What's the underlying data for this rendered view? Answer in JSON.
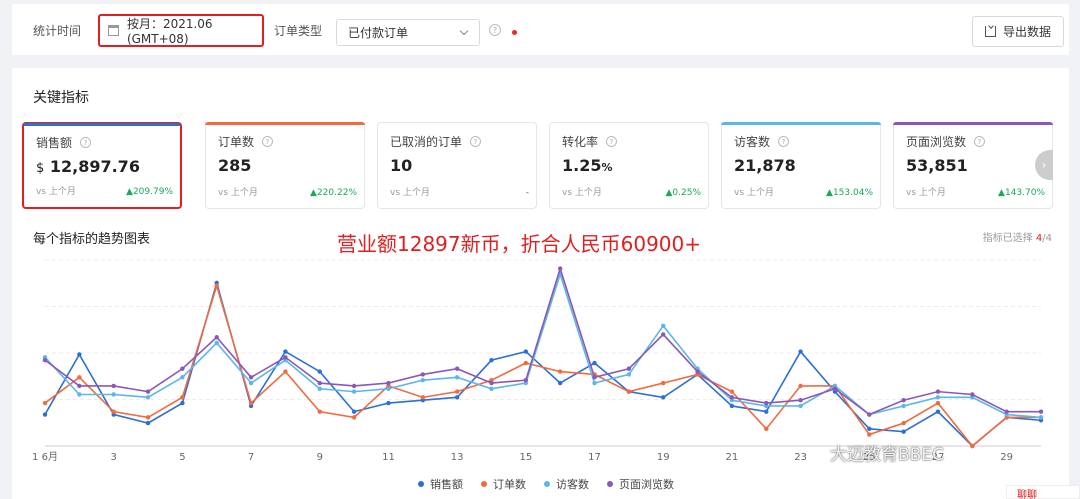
{
  "filters": {
    "time_label": "统计时间",
    "date_value": "按月：2021.06 (GMT+08)",
    "order_type_label": "订单类型",
    "order_type_value": "已付款订单",
    "export_label": "导出数据"
  },
  "section_title": "关键指标",
  "metrics": [
    {
      "title": "销售额",
      "currency": "$",
      "value": "12,897.76",
      "vs": "vs 上个月",
      "change": "209.79%",
      "bar_color": "#2b6fd8"
    },
    {
      "title": "订单数",
      "value": "285",
      "vs": "vs 上个月",
      "change": "220.22%",
      "bar_color": "#f26a3d"
    },
    {
      "title": "已取消的订单",
      "value": "10",
      "vs": "vs 上个月",
      "change": "-",
      "bar_color": ""
    },
    {
      "title": "转化率",
      "value": "1.25",
      "unit": "%",
      "vs": "vs 上个月",
      "change": "0.25%",
      "bar_color": ""
    },
    {
      "title": "访客数",
      "value": "21,878",
      "vs": "vs 上个月",
      "change": "153.04%",
      "bar_color": "#5bb7ea"
    },
    {
      "title": "页面浏览数",
      "value": "53,851",
      "vs": "vs 上个月",
      "change": "143.70%",
      "bar_color": "#8b57b8"
    }
  ],
  "trend": {
    "title": "每个指标的趋势图表",
    "annotation": "营业额12897新币，折合人民币60900+",
    "selected_label": "指标已选择",
    "selected_count": "4",
    "selected_total": "/4"
  },
  "chart_data": {
    "type": "line",
    "x_tick_labels": [
      "1 6月",
      "3",
      "5",
      "7",
      "9",
      "11",
      "13",
      "15",
      "17",
      "19",
      "21",
      "23",
      "25",
      "27",
      "29"
    ],
    "x": [
      1,
      2,
      3,
      4,
      5,
      6,
      7,
      8,
      9,
      10,
      11,
      12,
      13,
      14,
      15,
      16,
      17,
      18,
      19,
      20,
      21,
      22,
      23,
      24,
      25,
      26,
      27,
      28,
      29,
      30
    ],
    "series": [
      {
        "name": "销售额",
        "color": "#2b6fd8",
        "values": [
          11,
          32,
          11,
          8,
          15,
          57,
          14,
          33,
          26,
          12,
          15,
          16,
          17,
          30,
          33,
          22,
          29,
          19,
          17,
          25,
          14,
          12,
          33,
          19,
          6,
          5,
          12,
          0,
          10,
          9
        ]
      },
      {
        "name": "订单数",
        "color": "#f26a3d",
        "values": [
          15,
          24,
          12,
          10,
          17,
          56,
          15,
          26,
          12,
          10,
          21,
          17,
          19,
          23,
          29,
          26,
          25,
          19,
          22,
          25,
          19,
          6,
          21,
          21,
          4,
          8,
          15,
          0,
          10,
          10
        ]
      },
      {
        "name": "访客数",
        "color": "#5bb7ea",
        "values": [
          31,
          18,
          18,
          17,
          24,
          36,
          22,
          30,
          20,
          19,
          20,
          23,
          24,
          20,
          22,
          60,
          22,
          25,
          42,
          27,
          16,
          14,
          14,
          21,
          11,
          14,
          17,
          17,
          11,
          10
        ]
      },
      {
        "name": "页面浏览数",
        "color": "#8b57b8",
        "values": [
          30,
          21,
          21,
          19,
          27,
          38,
          24,
          31,
          22,
          21,
          22,
          25,
          27,
          22,
          23,
          62,
          24,
          27,
          39,
          26,
          17,
          15,
          16,
          20,
          11,
          16,
          19,
          18,
          12,
          12
        ]
      }
    ]
  },
  "watermark": "大迈教育BBEC",
  "corner_tab": "聊聊"
}
